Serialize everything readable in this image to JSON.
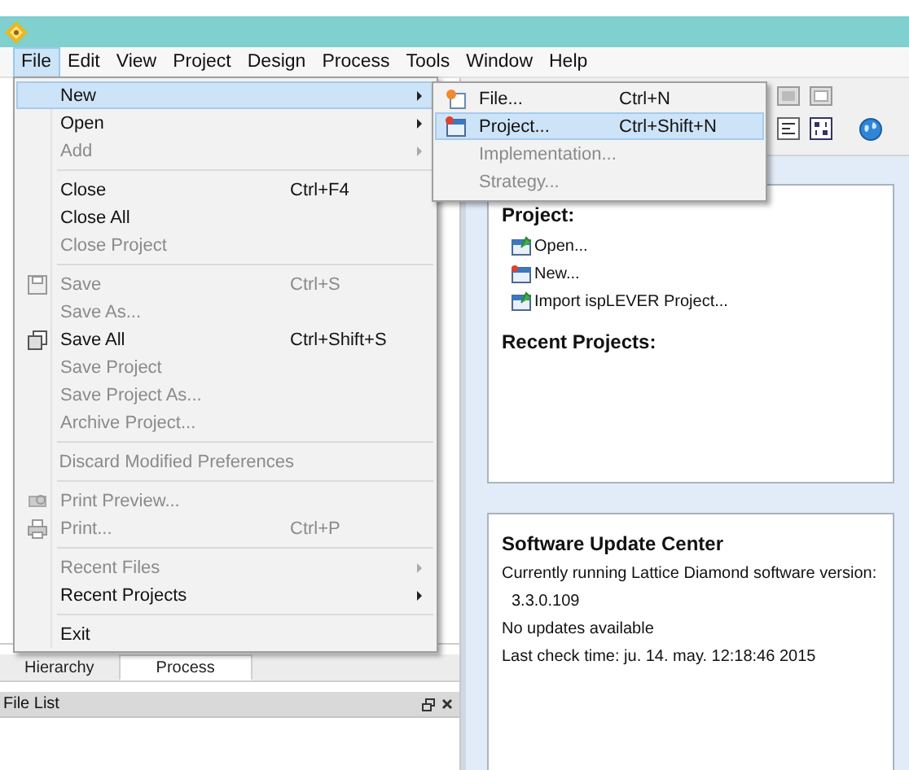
{
  "menu_bar": [
    {
      "label": "File",
      "selected": true
    },
    {
      "label": "Edit",
      "selected": false
    },
    {
      "label": "View",
      "selected": false
    },
    {
      "label": "Project",
      "selected": false
    },
    {
      "label": "Design",
      "selected": false
    },
    {
      "label": "Process",
      "selected": false
    },
    {
      "label": "Tools",
      "selected": false
    },
    {
      "label": "Window",
      "selected": false
    },
    {
      "label": "Help",
      "selected": false
    }
  ],
  "file_menu": [
    {
      "kind": "item",
      "label": "New",
      "submenu": true,
      "disabled": false,
      "selected": true
    },
    {
      "kind": "item",
      "label": "Open",
      "submenu": true,
      "disabled": false,
      "selected": false
    },
    {
      "kind": "item",
      "label": "Add",
      "submenu": true,
      "disabled": true,
      "selected": false
    },
    {
      "kind": "separator"
    },
    {
      "kind": "item",
      "label": "Close",
      "shortcut": "Ctrl+F4",
      "disabled": false,
      "selected": false
    },
    {
      "kind": "item",
      "label": "Close All",
      "disabled": false,
      "selected": false
    },
    {
      "kind": "item",
      "label": "Close Project",
      "disabled": true,
      "selected": false
    },
    {
      "kind": "separator"
    },
    {
      "kind": "item",
      "label": "Save",
      "shortcut": "Ctrl+S",
      "disabled": true,
      "selected": false
    },
    {
      "kind": "item",
      "label": "Save As...",
      "disabled": true,
      "selected": false
    },
    {
      "kind": "item",
      "label": "Save All",
      "shortcut": "Ctrl+Shift+S",
      "disabled": false,
      "selected": false
    },
    {
      "kind": "item",
      "label": "Save Project",
      "disabled": true,
      "selected": false
    },
    {
      "kind": "item",
      "label": "Save Project As...",
      "disabled": true,
      "selected": false
    },
    {
      "kind": "item",
      "label": "Archive Project...",
      "disabled": true,
      "selected": false
    },
    {
      "kind": "separator"
    },
    {
      "kind": "item",
      "label": "Discard Modified Preferences",
      "disabled": true,
      "selected": false
    },
    {
      "kind": "separator"
    },
    {
      "kind": "item",
      "label": "Print Preview...",
      "disabled": true,
      "selected": false
    },
    {
      "kind": "item",
      "label": "Print...",
      "shortcut": "Ctrl+P",
      "disabled": true,
      "selected": false
    },
    {
      "kind": "separator"
    },
    {
      "kind": "item",
      "label": "Recent Files",
      "submenu": true,
      "disabled": true,
      "selected": false
    },
    {
      "kind": "item",
      "label": "Recent Projects",
      "submenu": true,
      "disabled": false,
      "selected": false
    },
    {
      "kind": "separator"
    },
    {
      "kind": "item",
      "label": "Exit",
      "disabled": false,
      "selected": false
    }
  ],
  "new_submenu": [
    {
      "label": "File...",
      "shortcut": "Ctrl+N",
      "disabled": false,
      "selected": false
    },
    {
      "label": "Project...",
      "shortcut": "Ctrl+Shift+N",
      "disabled": false,
      "selected": true
    },
    {
      "label": "Implementation...",
      "disabled": true,
      "selected": false
    },
    {
      "label": "Strategy...",
      "disabled": true,
      "selected": false
    }
  ],
  "start_page": {
    "project_heading": "Project:",
    "project_links": [
      "Open...",
      "New...",
      "Import ispLEVER Project..."
    ],
    "recent_heading": "Recent Projects:"
  },
  "update_center": {
    "title": "Software Update Center",
    "intro": "Currently running Lattice Diamond software version:",
    "version": "3.3.0.109",
    "status": "No updates available",
    "last_check": "Last check time: ju. 14. may. 12:18:46 2015"
  },
  "bottom_tabs": [
    {
      "label": "Hierarchy",
      "selected": false
    },
    {
      "label": "Process",
      "selected": true
    }
  ],
  "file_list": {
    "title": "File List"
  }
}
